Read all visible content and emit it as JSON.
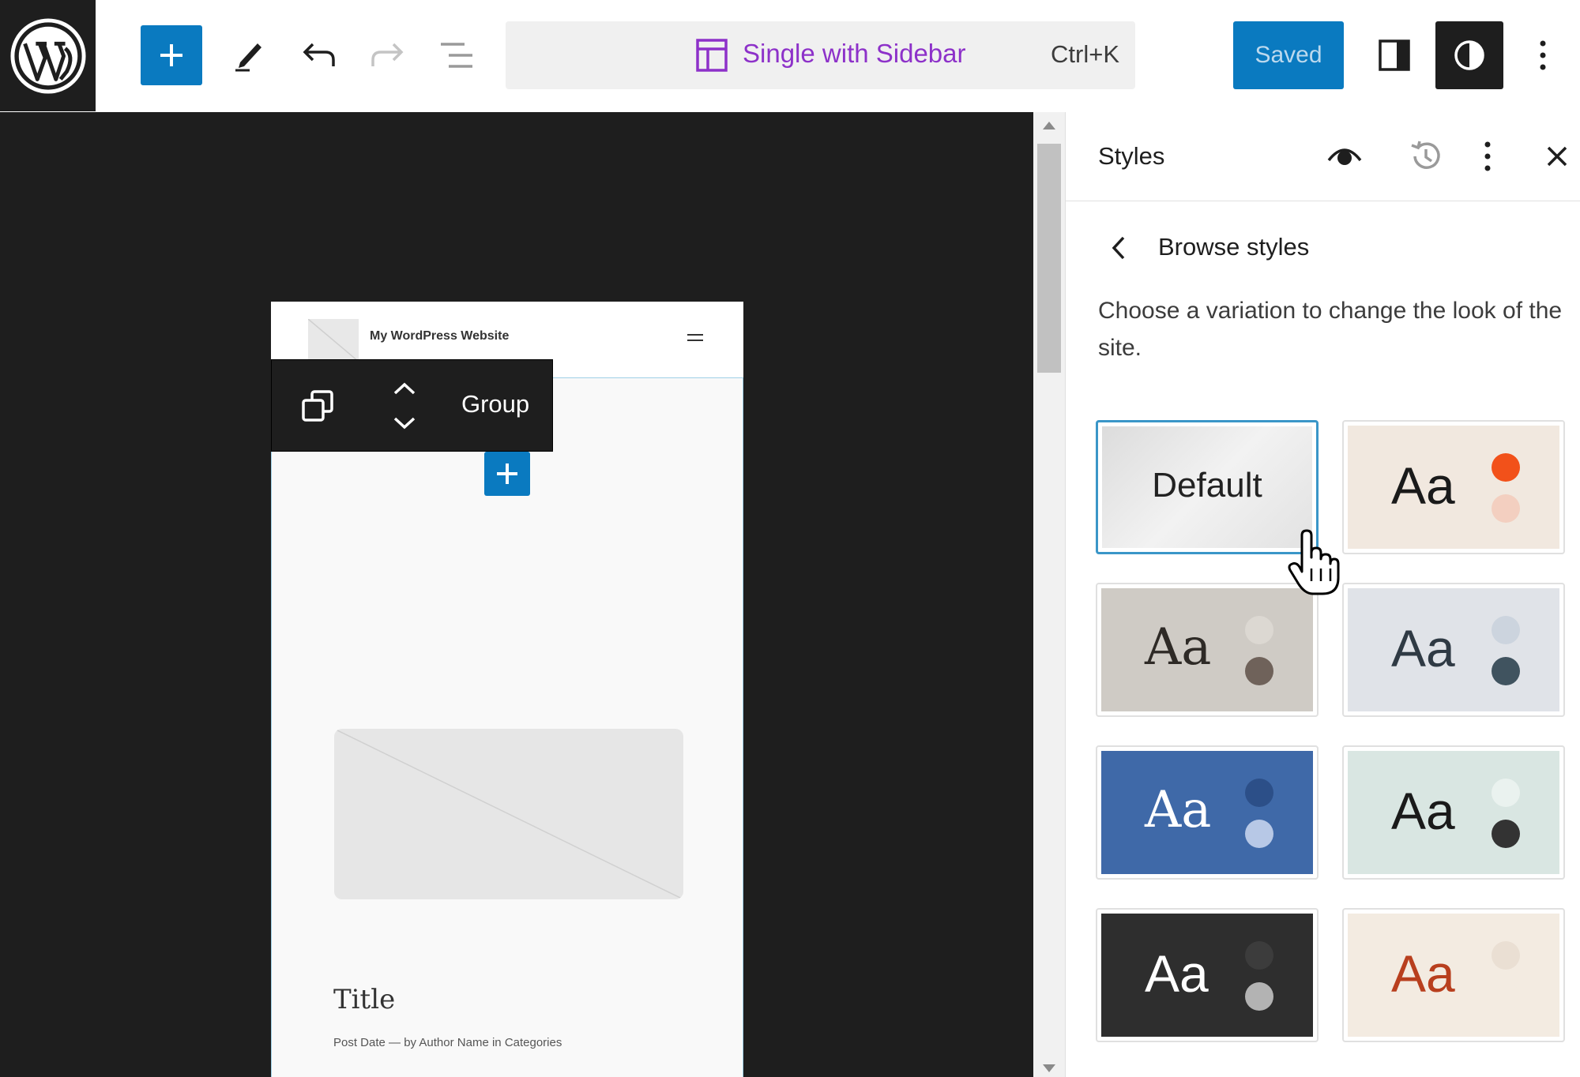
{
  "topbar": {
    "logo_icon": "wordpress-logo-icon",
    "add_icon": "plus-icon",
    "tools_icon": "pencil-icon",
    "undo_icon": "undo-icon",
    "redo_icon": "redo-icon",
    "list_view_icon": "list-view-icon",
    "template_icon": "template-layout-icon",
    "template_name": "Single with Sidebar",
    "shortcut": "Ctrl+K",
    "saved_label": "Saved",
    "settings_icon": "sidebar-toggle-icon",
    "styles_icon": "contrast-icon",
    "options_icon": "kebab-menu-icon",
    "accent_color": "#0a7ac0",
    "template_color": "#8d31c9"
  },
  "canvas": {
    "site_title": "My WordPress Website",
    "block_toolbar": {
      "duplicate_icon": "duplicate-icon",
      "move_icon": "move-up-down-icon",
      "block_label": "Group"
    },
    "inserter_icon": "plus-icon",
    "post_title": "Title",
    "meta": {
      "date": "Post Date",
      "sep": "—",
      "by": "by",
      "author": "Author Name",
      "in": "in",
      "categories": "Categories"
    }
  },
  "sidebar": {
    "title": "Styles",
    "preview_icon": "eye-icon",
    "revisions_icon": "history-icon",
    "more_icon": "kebab-menu-icon",
    "close_icon": "close-icon",
    "back_icon": "chevron-left-icon",
    "nav_title": "Browse styles",
    "description": "Choose a variation to change the look of the site.",
    "variations": [
      {
        "label": "Default",
        "sample": "",
        "bg": "#e9e9e9",
        "text_color": "#222222",
        "dots": [],
        "selected": true
      },
      {
        "label": "",
        "sample": "Aa",
        "bg": "#f1e8df",
        "text_color": "#1a1a1a",
        "dots": [
          "#f2511a",
          "#f3cfc0"
        ],
        "selected": false
      },
      {
        "label": "",
        "sample": "Aa",
        "bg": "#cfcbc5",
        "text_color": "#2e2a26",
        "dots": [
          "#dcd8d2",
          "#6f625a"
        ],
        "serif": true,
        "selected": false
      },
      {
        "label": "",
        "sample": "Aa",
        "bg": "#e0e3e8",
        "text_color": "#2f3a44",
        "dots": [
          "#ccd4de",
          "#40535f"
        ],
        "selected": false
      },
      {
        "label": "",
        "sample": "Aa",
        "bg": "#3f69a8",
        "text_color": "#ffffff",
        "dots": [
          "#2c4f88",
          "#b7c8e6"
        ],
        "serif": true,
        "selected": false
      },
      {
        "label": "",
        "sample": "Aa",
        "bg": "#d9e6e2",
        "text_color": "#1a1a1a",
        "dots": [
          "#eaf2ef",
          "#333333"
        ],
        "selected": false
      },
      {
        "label": "",
        "sample": "Aa",
        "bg": "#2e2e2e",
        "text_color": "#ffffff",
        "dots": [
          "#3c3c3c",
          "#b3b3b3"
        ],
        "selected": false
      },
      {
        "label": "",
        "sample": "Aa",
        "bg": "#f3ebe1",
        "text_color": "#b83f1e",
        "dots": [
          "#eadfd3",
          "#f3ebe1"
        ],
        "selected": false
      }
    ]
  },
  "cursor_icon": "hand-pointer-icon"
}
